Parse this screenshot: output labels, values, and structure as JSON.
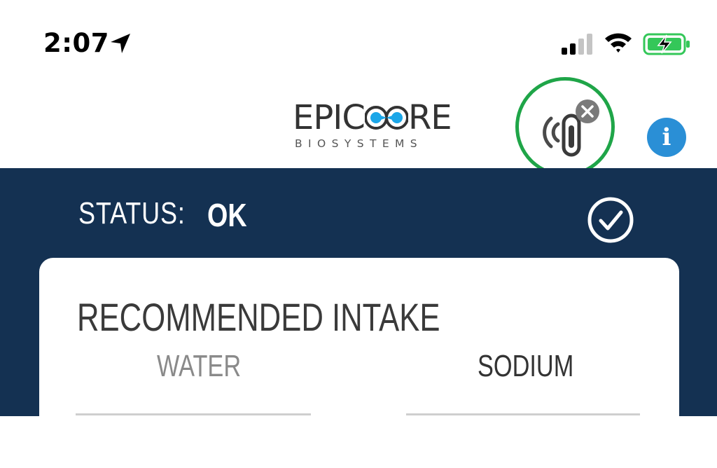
{
  "status_bar": {
    "time": "2:07",
    "icons": [
      "location-arrow-icon",
      "cellular-signal-icon",
      "wifi-icon",
      "battery-charging-icon"
    ],
    "battery_color": "#34c759"
  },
  "header": {
    "logo_word": [
      "EPIC",
      "RE"
    ],
    "logo_sub": "BIOSYSTEMS",
    "sensor_icon": "wearable-sensor-disconnected-icon",
    "sensor_ring_color": "#1fa548",
    "info_glyph": "i",
    "info_color": "#2a8fd6"
  },
  "status": {
    "label": "STATUS:",
    "value": "OK",
    "icon": "check-circle-icon",
    "panel_color": "#143152"
  },
  "intake": {
    "title": "RECOMMENDED INTAKE",
    "tabs": [
      {
        "label": "WATER",
        "selected": false
      },
      {
        "label": "SODIUM",
        "selected": true
      }
    ]
  }
}
